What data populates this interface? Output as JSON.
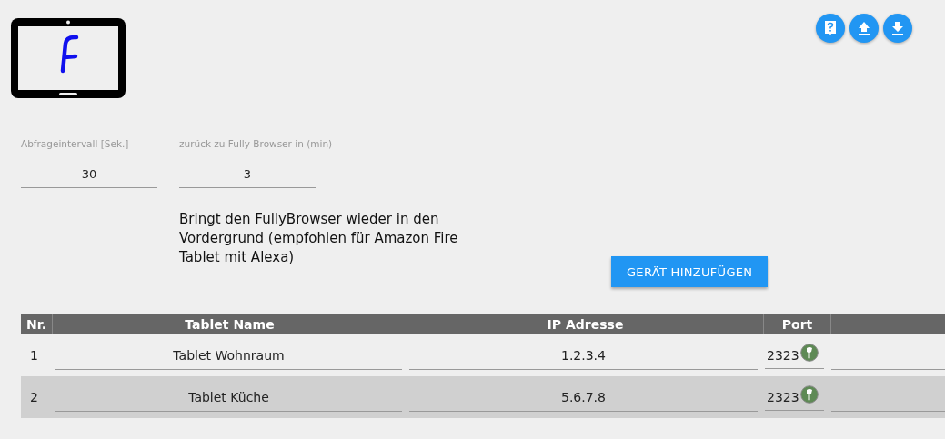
{
  "toolbar": {
    "buttons": [
      {
        "kind": "help"
      },
      {
        "kind": "upload"
      },
      {
        "kind": "download"
      }
    ]
  },
  "settings": [
    {
      "label": "Abfrageintervall [Sek.]",
      "value": "30"
    },
    {
      "label": "zurück zu Fully Browser in (min)",
      "value": "3"
    }
  ],
  "description": "Bringt den FullyBrowser wieder in den Vordergrund (empfohlen für Amazon Fire Tablet mit Alexa)",
  "add_button": "GERÄT HINZUFÜGEN",
  "table": {
    "columns": [
      "Nr.",
      "Tablet Name",
      "IP Adresse",
      "Port"
    ],
    "rows": [
      {
        "nr": "1",
        "name": "Tablet Wohnraum",
        "ip": "1.2.3.4",
        "port": "2323"
      },
      {
        "nr": "2",
        "name": "Tablet Küche",
        "ip": "5.6.7.8",
        "port": "2323"
      }
    ]
  }
}
